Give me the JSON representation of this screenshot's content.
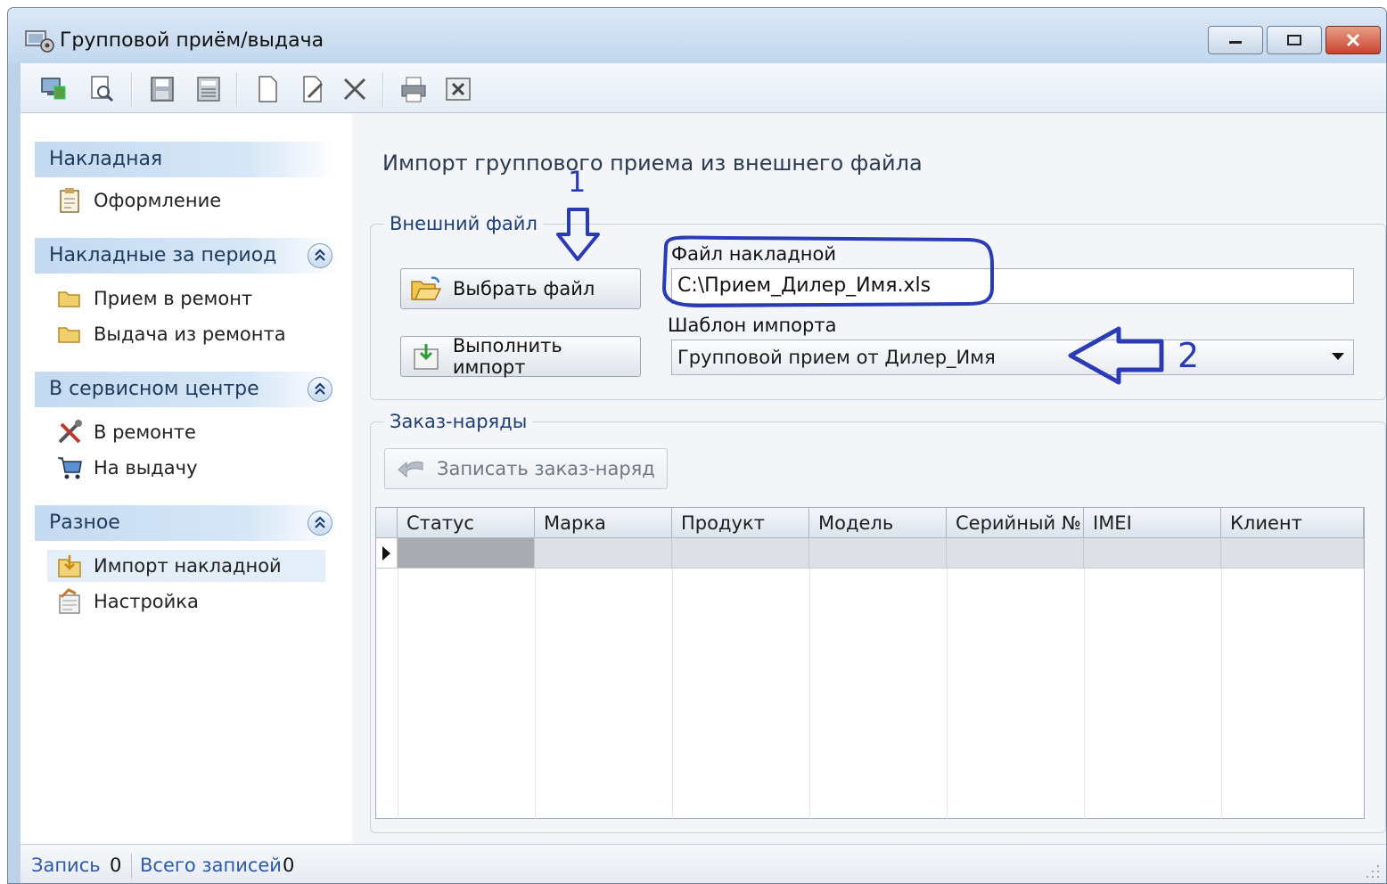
{
  "window": {
    "title": "Групповой приём/выдача"
  },
  "toolbar": {
    "buttons": [
      "computer-icon",
      "preview-icon",
      "save-icon",
      "save-all-icon",
      "new-doc-icon",
      "edit-icon",
      "delete-icon",
      "print-icon",
      "excel-icon"
    ]
  },
  "sidebar": {
    "group1": {
      "header": "Накладная",
      "items": [
        "Оформление"
      ]
    },
    "group2": {
      "header": "Накладные за период",
      "items": [
        "Прием в ремонт",
        "Выдача из ремонта"
      ]
    },
    "group3": {
      "header": "В сервисном центре",
      "items": [
        "В ремонте",
        "На выдачу"
      ]
    },
    "group4": {
      "header": "Разное",
      "items": [
        "Импорт накладной",
        "Настройка"
      ],
      "active": "Импорт накладной"
    }
  },
  "main": {
    "title": "Импорт группового приема из внешнего файла",
    "external_file": {
      "legend": "Внешний файл",
      "choose_button": "Выбрать файл",
      "import_button": "Выполнить импорт",
      "file_label": "Файл накладной",
      "file_value": "C:\\Прием_Дилер_Имя.xls",
      "template_label": "Шаблон импорта",
      "template_value": "Групповой прием от Дилер_Имя"
    },
    "orders": {
      "legend": "Заказ-наряды",
      "save_button": "Записать заказ-наряд",
      "columns": [
        "Статус",
        "Марка",
        "Продукт",
        "Модель",
        "Серийный №",
        "IMEI",
        "Клиент"
      ]
    }
  },
  "annotations": {
    "arrow1": "1",
    "arrow2": "2",
    "color": "#2b3bb3"
  },
  "statusbar": {
    "record_label": "Запись",
    "record_value": "0",
    "total_label": "Всего записей",
    "total_value": "0"
  }
}
